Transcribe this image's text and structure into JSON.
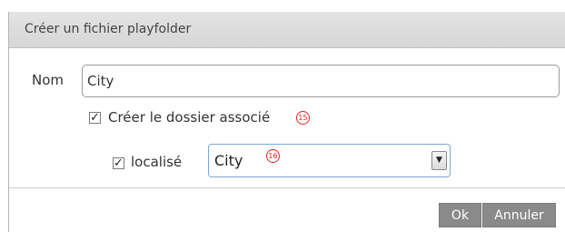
{
  "dialog": {
    "title": "Créer un fichier playfolder"
  },
  "form": {
    "nom_label": "Nom",
    "nom_value": "City",
    "create_folder": {
      "label": "Créer le dossier associé",
      "checked": true,
      "checkmark": "✓",
      "badge": "15"
    },
    "localise": {
      "label": "localisé",
      "checked": true,
      "checkmark": "✓",
      "badge": "16"
    },
    "select": {
      "value": "City",
      "arrow_icon": "chevron-down-icon",
      "arrow_glyph": "▼"
    }
  },
  "buttons": {
    "ok": "Ok",
    "cancel": "Annuler"
  },
  "colors": {
    "badge": "#d9271e",
    "button_bg": "#8a8a8a",
    "select_border": "#7ea6d6"
  }
}
